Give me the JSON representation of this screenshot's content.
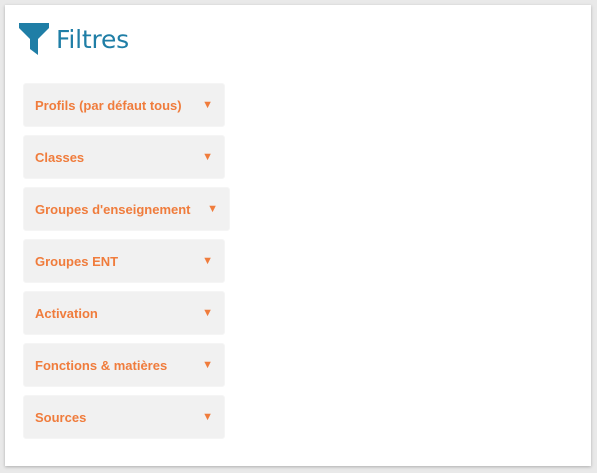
{
  "header": {
    "title": "Filtres",
    "icon": "funnel-icon",
    "color": "#1f7ea6"
  },
  "filters": [
    {
      "label": "Profils (par défaut tous)",
      "arrow": "▼"
    },
    {
      "label": "Classes",
      "arrow": "▼"
    },
    {
      "label": "Groupes d'enseignement",
      "arrow": "▼"
    },
    {
      "label": "Groupes ENT",
      "arrow": "▼"
    },
    {
      "label": "Activation",
      "arrow": "▼"
    },
    {
      "label": "Fonctions & matières",
      "arrow": "▼"
    },
    {
      "label": "Sources",
      "arrow": "▼"
    }
  ],
  "accent": "#f07c3c"
}
